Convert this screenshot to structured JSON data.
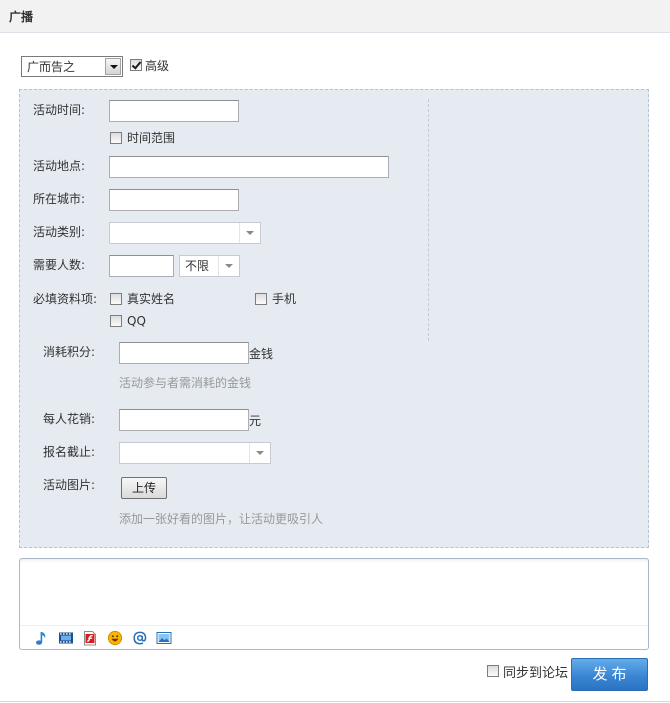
{
  "header": {
    "title": "广播"
  },
  "post_type": {
    "selected": "广而告之"
  },
  "advanced": {
    "label": "高级",
    "checked": true
  },
  "form": {
    "time": {
      "label": "活动时间:",
      "value": ""
    },
    "time_range": {
      "label": "时间范围",
      "checked": false
    },
    "place": {
      "label": "活动地点:",
      "value": ""
    },
    "city": {
      "label": "所在城市:",
      "value": ""
    },
    "category": {
      "label": "活动类别:",
      "selected": ""
    },
    "people": {
      "label": "需要人数:",
      "value": "",
      "limit_selected": "不限"
    },
    "required_info": {
      "label": "必填资料项:",
      "options": [
        {
          "label": "真实姓名",
          "checked": false
        },
        {
          "label": "手机",
          "checked": false
        },
        {
          "label": "QQ",
          "checked": false
        }
      ]
    },
    "credits": {
      "label": "消耗积分:",
      "value": "",
      "unit": "金钱",
      "hint": "活动参与者需消耗的金钱"
    },
    "cost": {
      "label": "每人花销:",
      "value": "",
      "unit": "元"
    },
    "deadline": {
      "label": "报名截止:",
      "selected": ""
    },
    "image": {
      "label": "活动图片:",
      "upload_label": "上传",
      "hint": "添加一张好看的图片，让活动更吸引人"
    }
  },
  "editor": {
    "content": "",
    "toolbar": [
      "music-icon",
      "video-icon",
      "flash-icon",
      "emoticon-icon",
      "at-icon",
      "image-icon"
    ]
  },
  "footer": {
    "sync_label": "同步到论坛",
    "sync_checked": false,
    "submit_label": "发布"
  },
  "theme": {
    "panel_bg": "#e5ebf1",
    "panel_border": "#b6c3d0",
    "accent": "#3a86d3",
    "hint": "#999999"
  }
}
